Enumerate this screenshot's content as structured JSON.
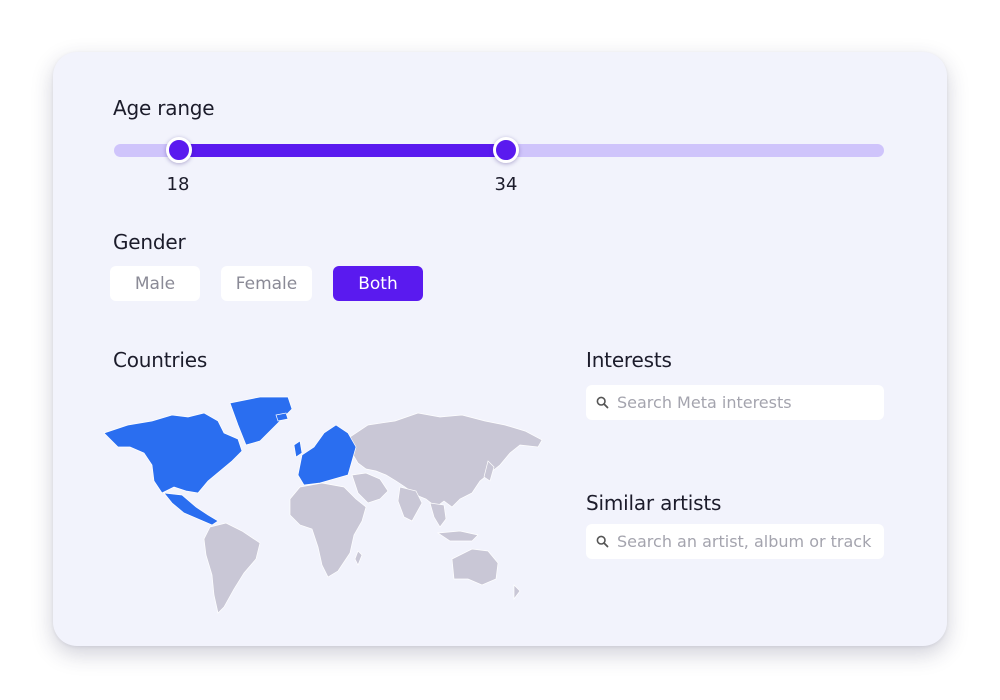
{
  "age": {
    "label": "Age range",
    "min_value": "18",
    "max_value": "34"
  },
  "gender": {
    "label": "Gender",
    "options": [
      "Male",
      "Female",
      "Both"
    ],
    "selected": "Both"
  },
  "countries": {
    "label": "Countries",
    "highlighted_regions": [
      "North America",
      "Europe",
      "Central America"
    ]
  },
  "interests": {
    "label": "Interests",
    "placeholder": "Search Meta interests"
  },
  "similar_artists": {
    "label": "Similar artists",
    "placeholder": "Search an artist, album or track"
  },
  "colors": {
    "accent": "#5a1aef",
    "track": "#cfc4fb",
    "map_selected": "#2a6ef0",
    "map_unselected": "#c9c7d6",
    "card_bg": "#f2f3fc"
  }
}
